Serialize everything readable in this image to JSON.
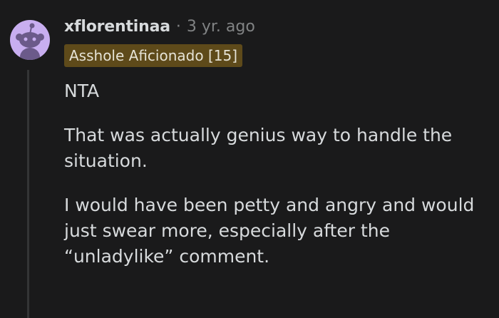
{
  "comment": {
    "username": "xflorentinaa",
    "separator": "·",
    "timestamp": "3 yr. ago",
    "flair": "Asshole Aficionado [15]",
    "paragraphs": [
      "NTA",
      "That was actually genius way to handle the situation.",
      "I would have been petty and angry and would just swear more, especially after the “unladylike” comment."
    ],
    "avatar_icon": "snoo-avatar-icon"
  },
  "colors": {
    "background": "#1a1a1b",
    "text": "#d7dadc",
    "muted": "#818384",
    "flair_bg": "#5e4a1a",
    "avatar_bg": "#c8aef0"
  }
}
